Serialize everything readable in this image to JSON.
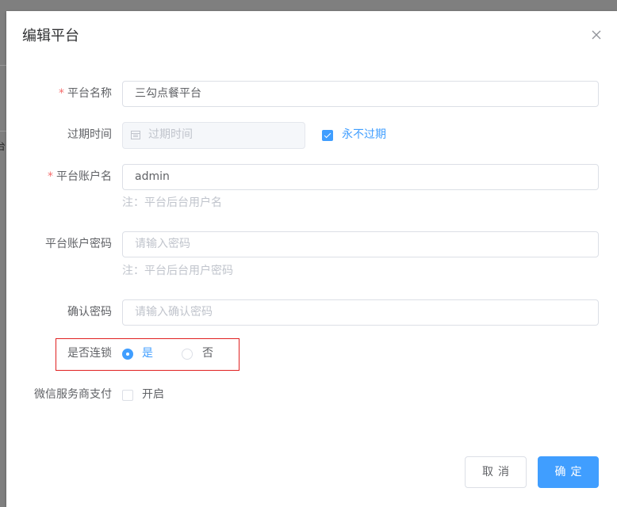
{
  "background": {
    "partial_text": "台"
  },
  "dialog": {
    "title": "编辑平台",
    "close_icon": "close-icon"
  },
  "form": {
    "platform_name": {
      "label": "平台名称",
      "required_mark": "*",
      "value": "三勾点餐平台"
    },
    "expire_time": {
      "label": "过期时间",
      "placeholder": "过期时间",
      "icon": "calendar-icon",
      "disabled": true,
      "never_expire_label": "永不过期",
      "never_expire_checked": true
    },
    "account_name": {
      "label": "平台账户名",
      "required_mark": "*",
      "value": "admin",
      "hint": "注：平台后台用户名"
    },
    "account_password": {
      "label": "平台账户密码",
      "placeholder": "请输入密码",
      "hint": "注：平台后台用户密码"
    },
    "confirm_password": {
      "label": "确认密码",
      "placeholder": "请输入确认密码"
    },
    "chain_lock": {
      "label": "是否连锁",
      "options": [
        "是",
        "否"
      ],
      "selected": "是"
    },
    "wechat_pay": {
      "label": "微信服务商支付",
      "option_label": "开启",
      "checked": false
    }
  },
  "footer": {
    "cancel_label": "取消",
    "confirm_label": "确定"
  },
  "colors": {
    "primary": "#409eff",
    "required": "#f56c6c",
    "highlight_border": "#e02020",
    "overlay": "#808080"
  }
}
